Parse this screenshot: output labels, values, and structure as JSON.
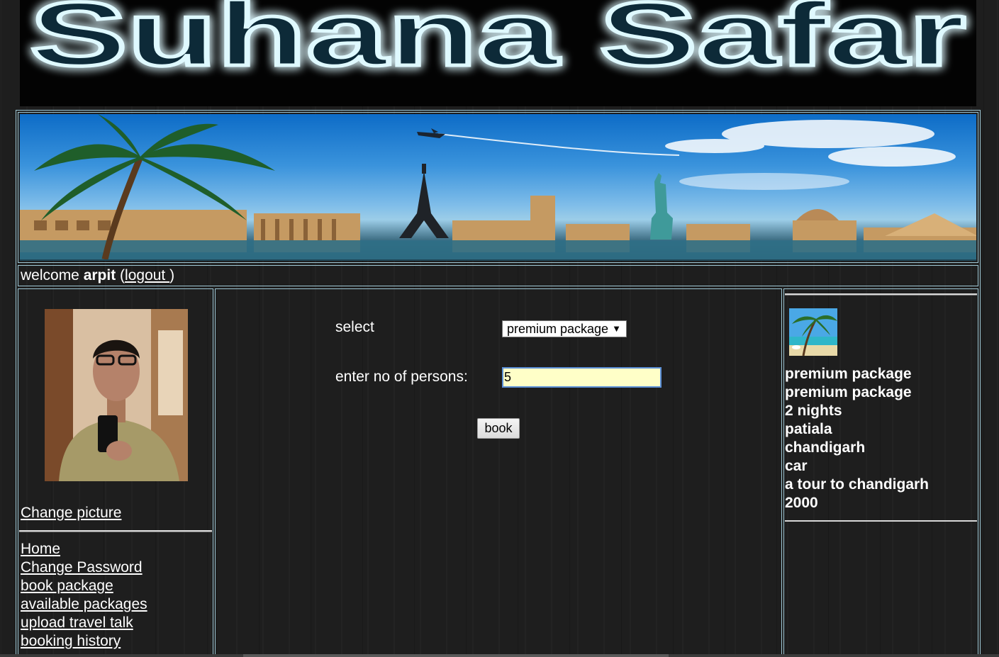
{
  "header": {
    "logo_text": "Suhana Safar",
    "logo_glow_color": "#1ad3ff"
  },
  "welcome": {
    "prefix": "welcome ",
    "username": "arpit",
    "open_paren": " (",
    "logout_label": "logout ",
    "close_paren": ")"
  },
  "sidebar": {
    "change_picture": "Change picture",
    "nav": [
      {
        "label": "Home "
      },
      {
        "label": "Change Password"
      },
      {
        "label": "book package "
      },
      {
        "label": "available packages"
      },
      {
        "label": "upload travel talk"
      },
      {
        "label": "booking history"
      }
    ]
  },
  "form": {
    "select_label": "select",
    "select_value": "premium package",
    "persons_label": "enter no of persons:",
    "persons_value": "5",
    "book_label": "book"
  },
  "package": {
    "lines": [
      "premium package",
      "premium package",
      "2 nights",
      "patiala",
      "chandigarh",
      "car",
      "a tour to chandigarh",
      "2000"
    ]
  },
  "colors": {
    "border": "#9fc8d6",
    "input_bg": "#ffffc8",
    "input_border": "#5b8fd6"
  }
}
